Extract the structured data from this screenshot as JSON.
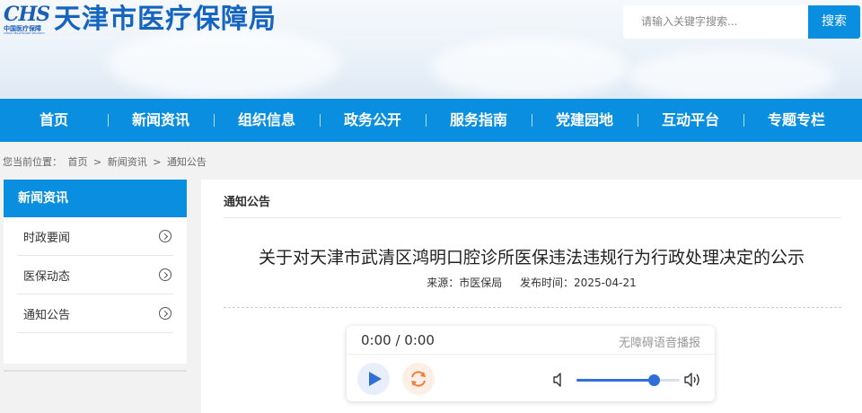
{
  "header": {
    "logo_mark": "CHS",
    "logo_sub": "中国医疗保障",
    "logo_sub2": "CHINA HEALTHCARE SECURITY",
    "site_title": "天津市医疗保障局"
  },
  "search": {
    "placeholder": "请输入关键字搜索...",
    "button_label": "搜索"
  },
  "nav": {
    "items": [
      {
        "label": "首页"
      },
      {
        "label": "新闻资讯"
      },
      {
        "label": "组织信息"
      },
      {
        "label": "政务公开"
      },
      {
        "label": "服务指南"
      },
      {
        "label": "党建园地"
      },
      {
        "label": "互动平台"
      },
      {
        "label": "专题专栏"
      }
    ]
  },
  "breadcrumb": {
    "prefix": "您当前位置：",
    "items": [
      "首页",
      ">",
      "新闻资讯",
      ">",
      "通知公告"
    ]
  },
  "sidebar": {
    "title": "新闻资讯",
    "items": [
      {
        "label": "时政要闻",
        "icon": "chevron-right-circle-icon"
      },
      {
        "label": "医保动态",
        "icon": "chevron-right-circle-icon"
      },
      {
        "label": "通知公告",
        "icon": "chevron-right-circle-icon"
      }
    ]
  },
  "main": {
    "section_title": "通知公告",
    "article_title": "关于对天津市武清区鸿明口腔诊所医保违法违规行为行政处理决定的公示",
    "source": "来源：市医保局",
    "publish_time": "发布时间：2025-04-21"
  },
  "player": {
    "time": "0:00 / 0:00",
    "tts_label": "无障碍语音播报",
    "volume_fraction": 0.75
  },
  "colors": {
    "primary": "#0a8ee0",
    "title_blue": "#1565c0",
    "player_blue": "#2f6fd6",
    "loop_orange": "#f07a3a"
  }
}
